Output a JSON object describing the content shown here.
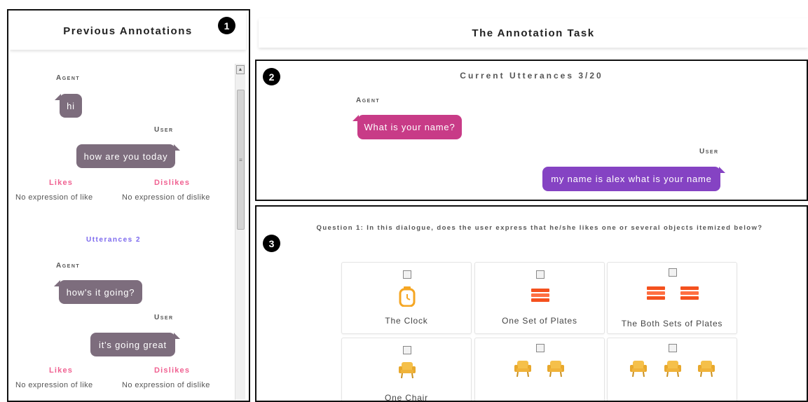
{
  "markers": [
    "1",
    "2",
    "3"
  ],
  "left_panel": {
    "title": "Previous Annotations",
    "scroll_up": "▲",
    "scroll_grip": "≡",
    "utterance1": {
      "agent_label": "Agent",
      "agent_text": "hi",
      "user_label": "User",
      "user_text": "how are you today",
      "likes_label": "Likes",
      "dislikes_label": "Dislikes",
      "likes_value": "No expression of like",
      "dislikes_value": "No expression of dislike"
    },
    "utterance2": {
      "heading": "Utterances 2",
      "agent_label": "Agent",
      "agent_text": "how's it going?",
      "user_label": "User",
      "user_text": "it's going great",
      "likes_label": "Likes",
      "dislikes_label": "Dislikes",
      "likes_value": "No expression of like",
      "dislikes_value": "No expression of dislike"
    }
  },
  "task": {
    "title": "The Annotation Task",
    "current": {
      "title": "Current Utterances 3/20",
      "agent_label": "Agent",
      "agent_text": "What is your name?",
      "user_label": "User",
      "user_text": "my name is alex what is your name"
    },
    "question": {
      "text": "Question 1: In this dialogue, does the user express that he/she likes one or several objects itemized below?",
      "options": [
        {
          "label": "The Clock",
          "icon": "clock-icon"
        },
        {
          "label": "One Set of Plates",
          "icon": "plates-icon"
        },
        {
          "label": "The Both Sets of Plates",
          "icon": "plates-icon"
        },
        {
          "label": "One Chair",
          "icon": "chair-icon"
        },
        {
          "label": "",
          "icon": "chair-icon"
        },
        {
          "label": "",
          "icon": "chair-icon"
        }
      ]
    }
  },
  "colors": {
    "gray_bubble": "#7d6d7d",
    "pink_bubble": "#c83b87",
    "purple_bubble": "#8543c3",
    "likes": "#f06292",
    "utterance_heading": "#7b68ee",
    "icon_orange": "#f5a623"
  }
}
